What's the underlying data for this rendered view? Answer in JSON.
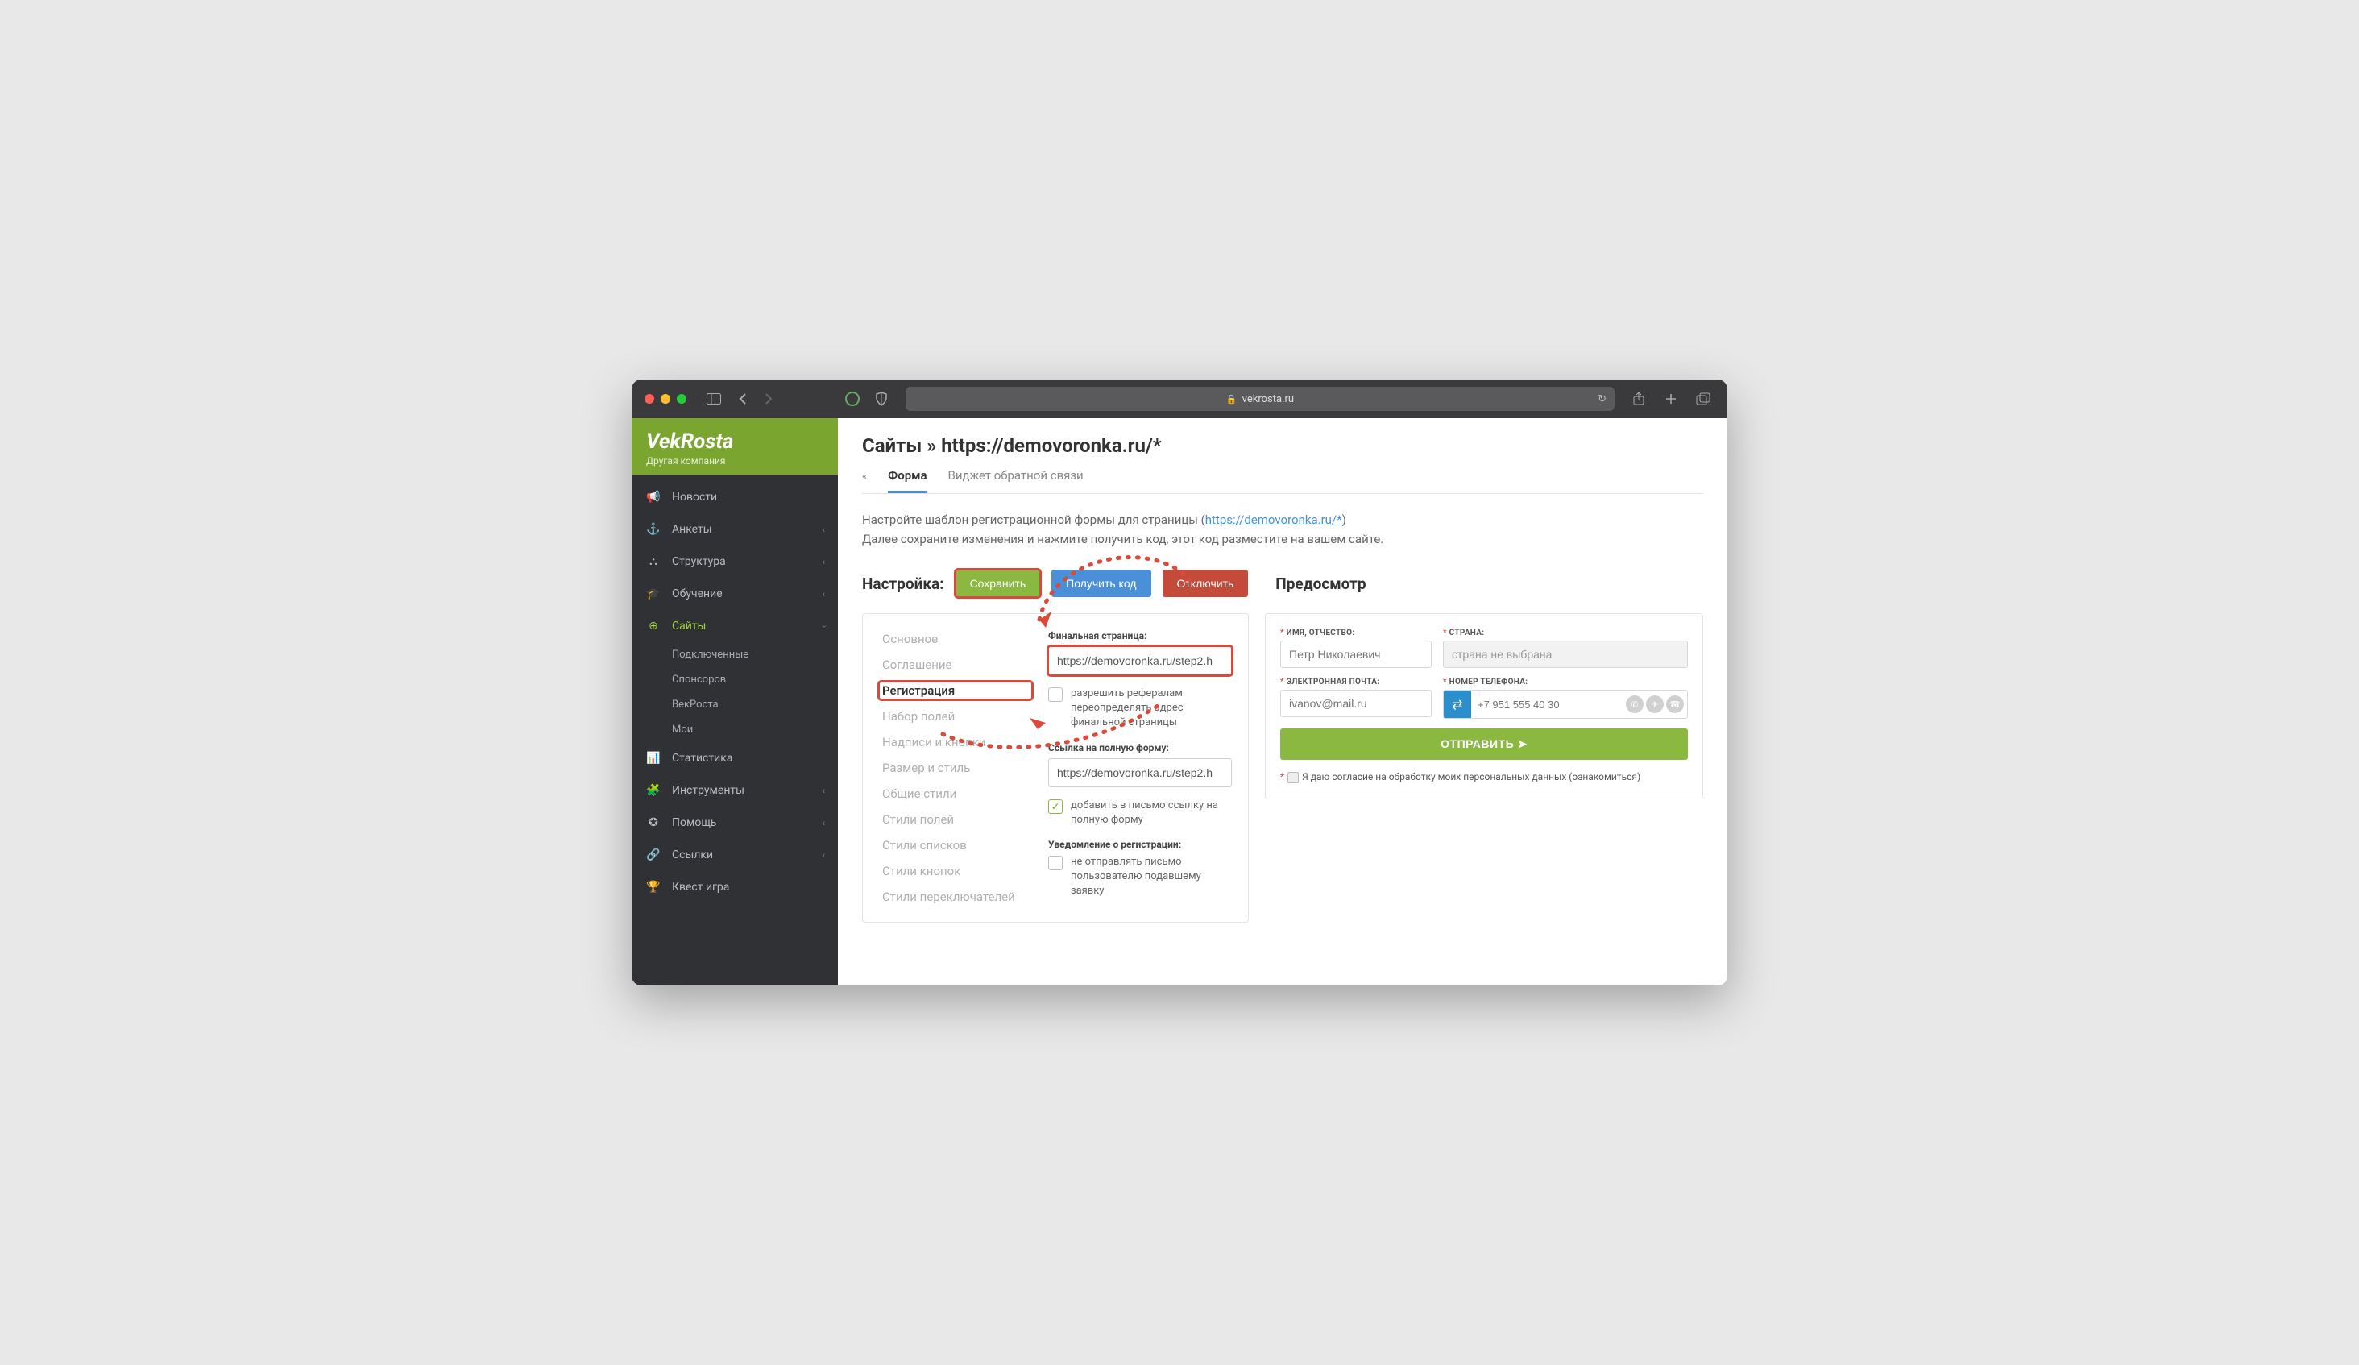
{
  "browser": {
    "url_host": "vekrosta.ru"
  },
  "brand": {
    "name": "VekRosta",
    "subtitle": "Другая компания"
  },
  "sidebar": {
    "items": [
      {
        "label": "Новости",
        "icon": "📢"
      },
      {
        "label": "Анкеты",
        "icon": "⚓",
        "has_sub": true
      },
      {
        "label": "Структура",
        "icon": "⛬",
        "has_sub": true
      },
      {
        "label": "Обучение",
        "icon": "🎓",
        "has_sub": true
      },
      {
        "label": "Сайты",
        "icon": "⊕",
        "active": true,
        "expanded": true,
        "subs": [
          "Подключенные",
          "Спонсоров",
          "ВекРоста",
          "Мои"
        ]
      },
      {
        "label": "Статистика",
        "icon": "📊"
      },
      {
        "label": "Инструменты",
        "icon": "🧩",
        "has_sub": true
      },
      {
        "label": "Помощь",
        "icon": "✪",
        "has_sub": true
      },
      {
        "label": "Ссылки",
        "icon": "🔗",
        "has_sub": true
      },
      {
        "label": "Квест игра",
        "icon": "🏆"
      }
    ]
  },
  "page": {
    "title": "Сайты » https://demovoronka.ru/*",
    "tabs": {
      "back": "«",
      "active": "Форма",
      "other": "Виджет обратной связи"
    },
    "intro_prefix": "Настройте шаблон регистрационной формы для страницы (",
    "intro_link": "https://demovoronka.ru/*",
    "intro_suffix": ")",
    "intro_line2": "Далее сохраните изменения и нажмите получить код, этот код разместите на вашем сайте.",
    "config_label": "Настройка:",
    "buttons": {
      "save": "Сохранить",
      "get_code": "Получить код",
      "disable": "Отключить"
    },
    "preview_label": "Предосмотр"
  },
  "settings_nav": [
    "Основное",
    "Соглашение",
    "Регистрация",
    "Набор полей",
    "Надписи и кнопки",
    "Размер и стиль",
    "Общие стили",
    "Стили полей",
    "Стили списков",
    "Стили кнопок",
    "Стили переключателей"
  ],
  "settings_active_index": 2,
  "form": {
    "final_page_label": "Финальная страница:",
    "final_page_value": "https://demovoronka.ru/step2.h",
    "allow_referrals": "разрешить рефералам переопределять адрес финальной страницы",
    "full_form_label": "Ссылка на полную форму:",
    "full_form_value": "https://demovoronka.ru/step2.h",
    "add_link_email": "добавить в письмо ссылку на полную форму",
    "notify_label": "Уведомление о регистрации:",
    "no_send": "не отправлять письмо пользователю подавшему заявку"
  },
  "preview": {
    "name_label": "ИМЯ, ОТЧЕСТВО:",
    "name_placeholder": "Петр Николаевич",
    "country_label": "СТРАНА:",
    "country_value": "страна не выбрана",
    "email_label": "ЭЛЕКТРОННАЯ ПОЧТА:",
    "email_placeholder": "ivanov@mail.ru",
    "phone_label": "НОМЕР ТЕЛЕФОНА:",
    "phone_placeholder": "+7 951 555 40 30",
    "submit": "ОТПРАВИТЬ ➤",
    "consent": "Я даю согласие на обработку моих персональных данных (ознакомиться)"
  }
}
